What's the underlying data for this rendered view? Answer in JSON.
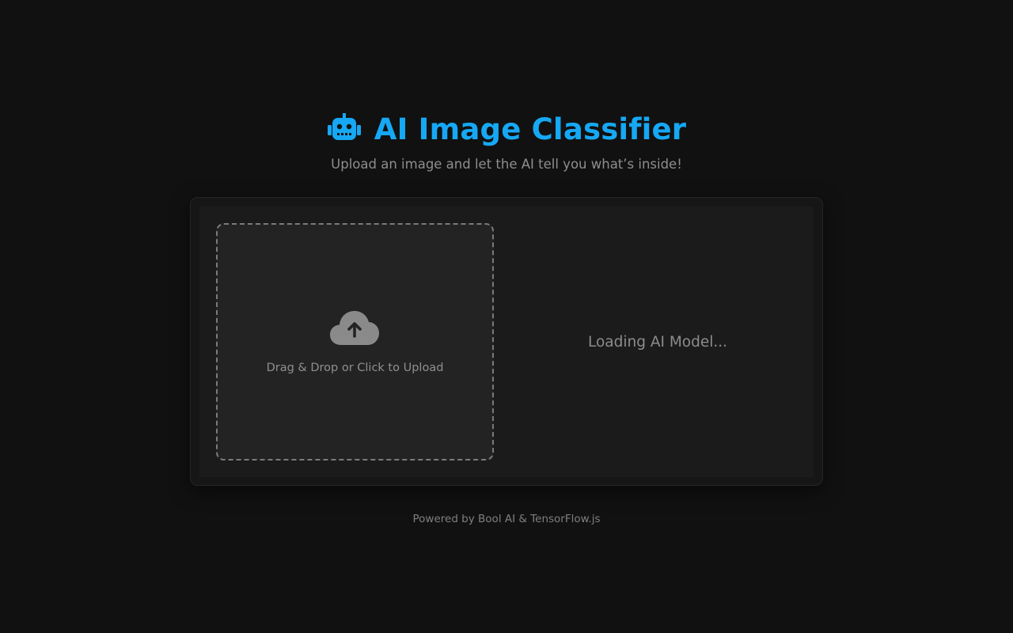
{
  "header": {
    "icon": "robot-icon",
    "title": "AI Image Classifier",
    "subtitle": "Upload an image and let the AI tell you what’s inside!"
  },
  "upload": {
    "icon": "cloud-upload-icon",
    "label": "Drag & Drop or Click to Upload"
  },
  "status": {
    "text": "Loading AI Model..."
  },
  "footer": {
    "text": "Powered by Bool AI & TensorFlow.js"
  },
  "colors": {
    "accent": "#16a8f4",
    "background": "#111111",
    "muted_text": "#8e8e8e"
  }
}
